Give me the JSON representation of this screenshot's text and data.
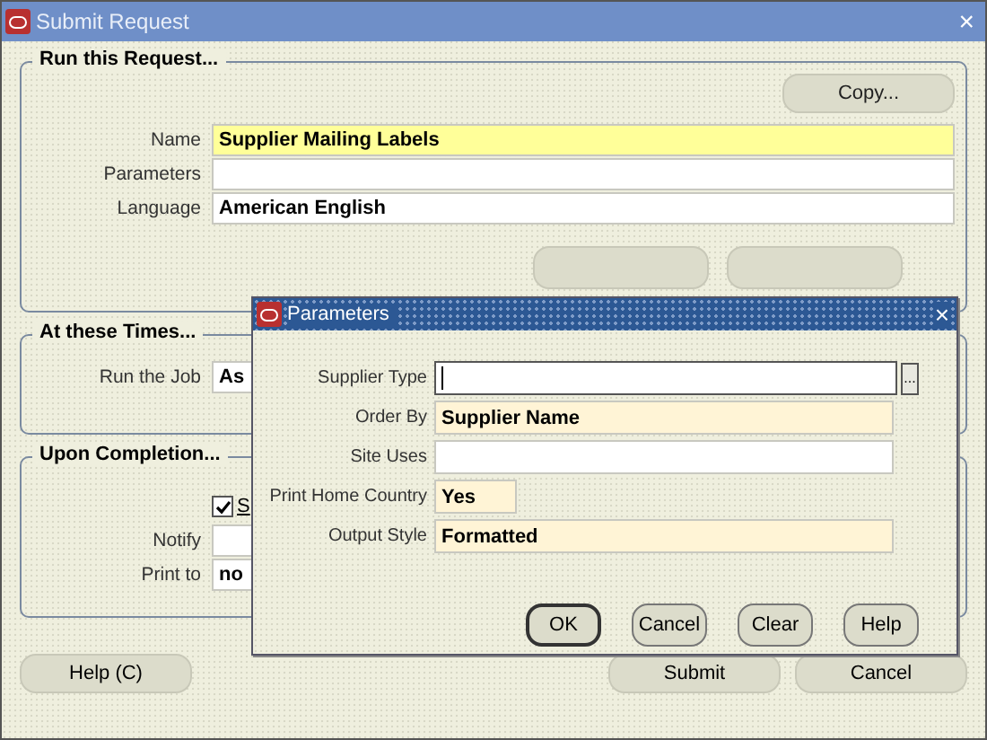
{
  "window": {
    "title": "Submit Request",
    "close": "×"
  },
  "request": {
    "title": "Run this Request...",
    "copy_button": "Copy...",
    "fields": [
      {
        "label": "Name",
        "value": "Supplier Mailing Labels",
        "kind": "current"
      },
      {
        "label": "Parameters",
        "kind": "plain"
      },
      {
        "label": "Language",
        "value": "American English",
        "kind": "plain"
      }
    ]
  },
  "times": {
    "title": "At these Times...",
    "fields": [
      {
        "label": "Run the Job",
        "value": "As"
      }
    ]
  },
  "completion": {
    "title": "Upon Completion...",
    "checkbox": {
      "label": "S",
      "checked": true
    },
    "fields": [
      {
        "label": "Notify"
      },
      {
        "label": "Print to",
        "value": "no"
      }
    ]
  },
  "buttons": [
    {
      "label": "Help (C)"
    },
    {
      "label": "Submit"
    },
    {
      "label": "Cancel"
    }
  ],
  "dialog": {
    "title": "Parameters",
    "close": "×",
    "fields": [
      {
        "label": "Supplier Type",
        "kind": "plain",
        "lov": true,
        "focused": true
      },
      {
        "label": "Order By",
        "value": "Supplier Name",
        "kind": "required",
        "lov": false,
        "focused": false
      },
      {
        "label": "Site Uses",
        "kind": "plain",
        "lov": false,
        "focused": false
      },
      {
        "label": "Print Home Country",
        "value": "Yes",
        "kind": "flag",
        "lov": false,
        "focused": false
      },
      {
        "label": "Output Style",
        "value": "Formatted",
        "kind": "required",
        "lov": false,
        "focused": false
      }
    ],
    "lov_button": "...",
    "buttons": [
      {
        "label": "OK",
        "default": true
      },
      {
        "label": "Cancel",
        "default": false
      },
      {
        "label": "Clear",
        "default": false
      },
      {
        "label": "Help",
        "default": false
      }
    ]
  }
}
